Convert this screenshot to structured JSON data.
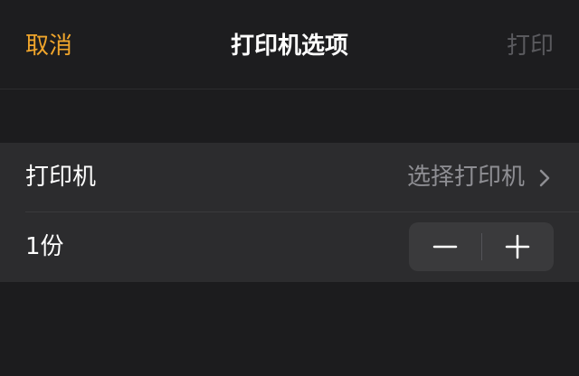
{
  "nav": {
    "cancel_label": "取消",
    "title": "打印机选项",
    "print_label": "打印"
  },
  "printer_row": {
    "label": "打印机",
    "value": "选择打印机",
    "icon": "chevron-right-icon"
  },
  "copies_row": {
    "label": "1份",
    "copies": 1,
    "stepper": {
      "minus_icon": "minus-icon",
      "plus_icon": "plus-icon"
    }
  },
  "colors": {
    "accent": "#f0a52b",
    "background": "#1c1c1e",
    "cell_background": "#2c2c2e",
    "secondary_text": "#8e8e93",
    "disabled_text": "#5a5a5e"
  }
}
